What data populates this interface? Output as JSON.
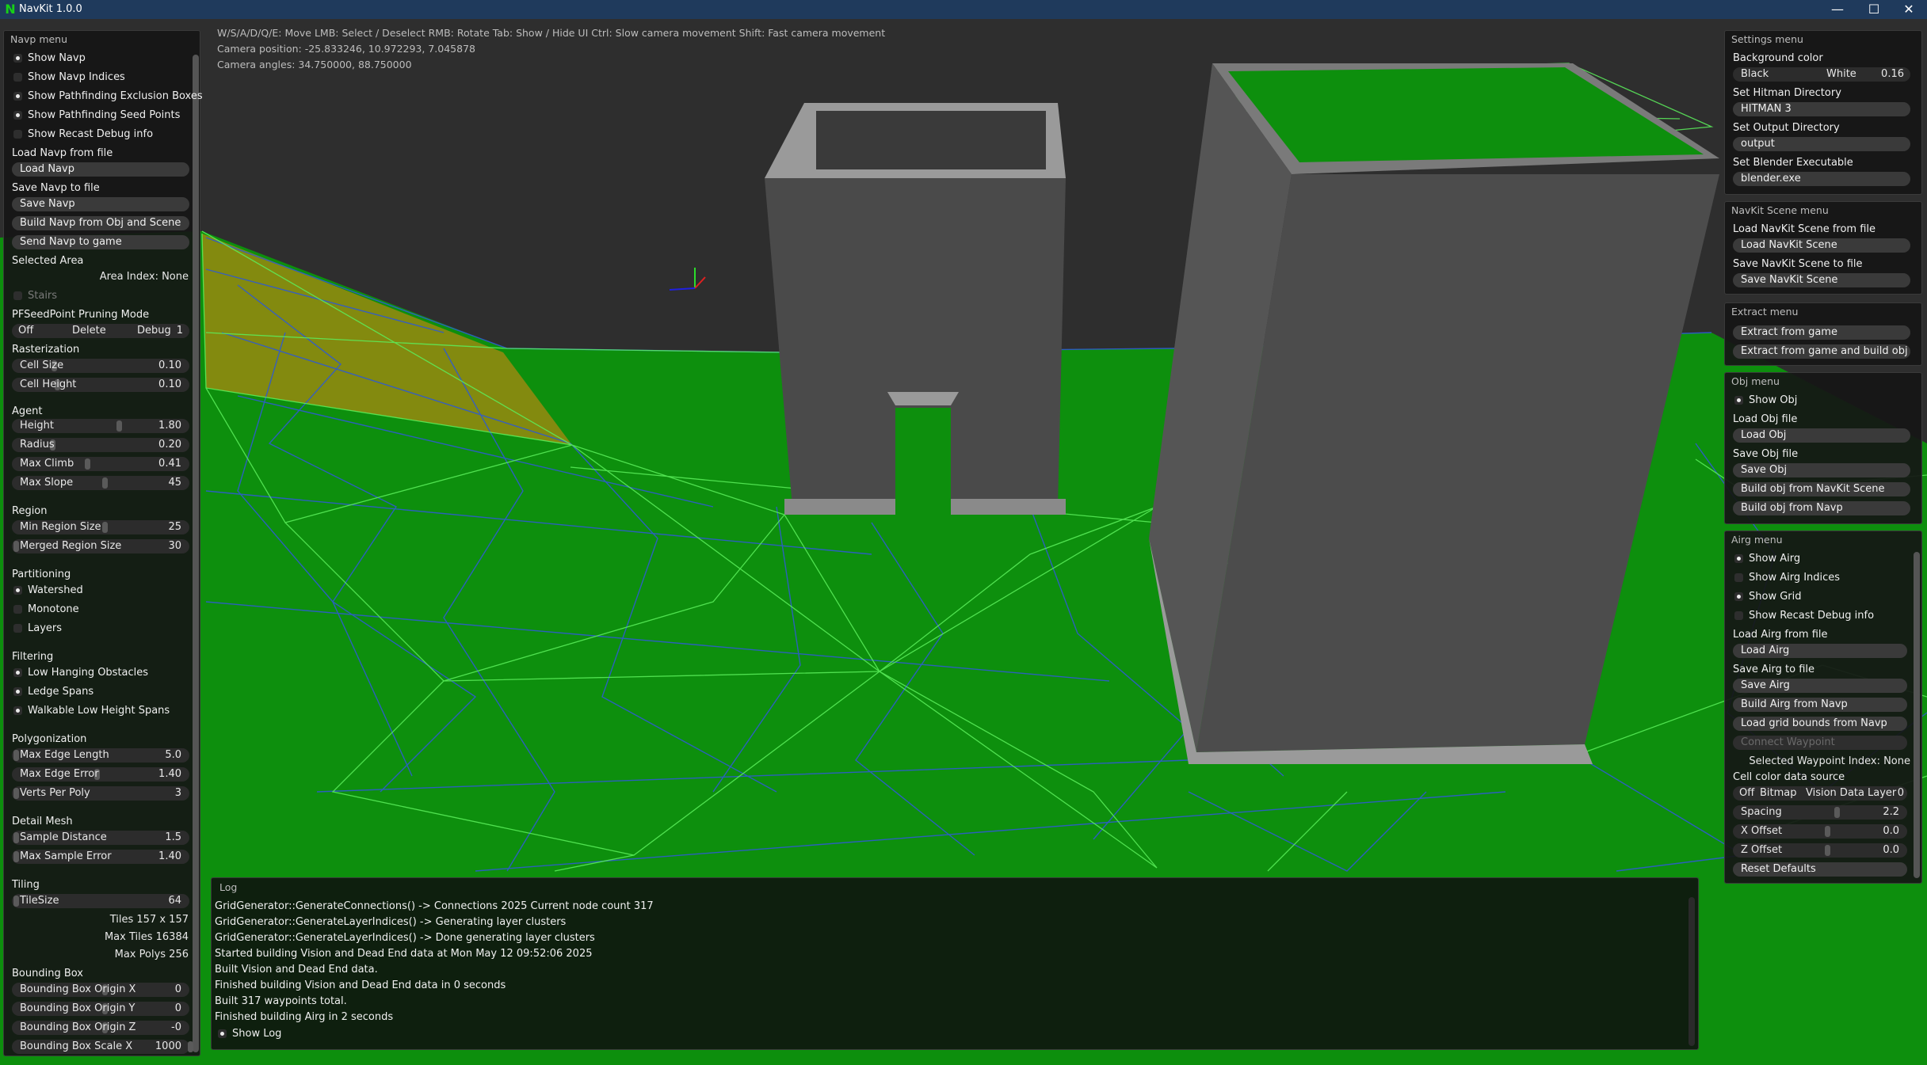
{
  "window": {
    "title": "NavKit 1.0.0",
    "logo": "N",
    "buttons": {
      "minimize": "—",
      "maximize": "☐",
      "close": "✕"
    }
  },
  "hints": [
    "W/S/A/D/Q/E: Move  LMB: Select / Deselect RMB: Rotate  Tab: Show / Hide UI  Ctrl: Slow camera movement  Shift: Fast camera movement",
    "Camera position: -25.833246, 10.972293, 7.045878",
    "Camera angles: 34.750000, 88.750000"
  ],
  "colors": {
    "ground": "#0d8f0d",
    "selected_area": "#8a8a10",
    "edge": "#2f5bcf",
    "grid": "#5cf05c",
    "building": "#4a4a4a"
  },
  "navp": {
    "title": "Navp menu",
    "checks": [
      {
        "label": "Show Navp",
        "checked": true
      },
      {
        "label": "Show Navp Indices",
        "checked": false
      },
      {
        "label": "Show Pathfinding Exclusion Boxes",
        "checked": true
      },
      {
        "label": "Show Pathfinding Seed Points",
        "checked": true
      },
      {
        "label": "Show Recast Debug info",
        "checked": false
      }
    ],
    "load_heading": "Load Navp from file",
    "load_btn": "Load Navp",
    "save_heading": "Save Navp to file",
    "save_btn": "Save Navp",
    "build_btn": "Build Navp from Obj and Scene",
    "send_btn": "Send Navp to game",
    "selected_area": "Selected Area",
    "area_index": "Area Index: None",
    "stairs": "Stairs",
    "pruning": {
      "heading": "PFSeedPoint Pruning Mode",
      "off": "Off",
      "delete": "Delete",
      "debug": "Debug",
      "value": "1"
    },
    "rasterization": {
      "heading": "Rasterization",
      "cell_size": {
        "label": "Cell Size",
        "value": "0.10"
      },
      "cell_height": {
        "label": "Cell Height",
        "value": "0.10"
      }
    },
    "agent": {
      "heading": "Agent",
      "height": {
        "label": "Height",
        "value": "1.80"
      },
      "radius": {
        "label": "Radius",
        "value": "0.20"
      },
      "max_climb": {
        "label": "Max Climb",
        "value": "0.41"
      },
      "max_slope": {
        "label": "Max Slope",
        "value": "45"
      }
    },
    "region": {
      "heading": "Region",
      "min": {
        "label": "Min Region Size",
        "value": "25"
      },
      "merged": {
        "label": "Merged Region Size",
        "value": "30"
      }
    },
    "partitioning": {
      "heading": "Partitioning",
      "watershed": "Watershed",
      "monotone": "Monotone",
      "layers": "Layers"
    },
    "filtering": {
      "heading": "Filtering",
      "low": "Low Hanging Obstacles",
      "ledge": "Ledge Spans",
      "walkable": "Walkable Low Height Spans"
    },
    "poly": {
      "heading": "Polygonization",
      "max_edge_len": {
        "label": "Max Edge Length",
        "value": "5.0"
      },
      "max_edge_err": {
        "label": "Max Edge Error",
        "value": "1.40"
      },
      "verts": {
        "label": "Verts Per Poly",
        "value": "3"
      }
    },
    "detail": {
      "heading": "Detail Mesh",
      "sample": {
        "label": "Sample Distance",
        "value": "1.5"
      },
      "max_err": {
        "label": "Max Sample Error",
        "value": "1.40"
      }
    },
    "tiling": {
      "heading": "Tiling",
      "tilesize": {
        "label": "TileSize",
        "value": "64"
      },
      "tiles": "Tiles  157 x 157",
      "max_tiles": "Max Tiles  16384",
      "max_polys": "Max Polys  256"
    },
    "bbox": {
      "heading": "Bounding Box",
      "ox": {
        "label": "Bounding Box Origin X",
        "value": "0"
      },
      "oy": {
        "label": "Bounding Box Origin Y",
        "value": "0"
      },
      "oz": {
        "label": "Bounding Box Origin Z",
        "value": "-0"
      },
      "sx": {
        "label": "Bounding Box Scale X",
        "value": "1000"
      }
    }
  },
  "settings": {
    "title": "Settings menu",
    "bg_heading": "Background color",
    "bg_black": "Black",
    "bg_white": "White",
    "bg_value": "0.16",
    "hitman_heading": "Set Hitman Directory",
    "hitman_value": "HITMAN 3",
    "output_heading": "Set Output Directory",
    "output_value": "output",
    "blender_heading": "Set Blender Executable",
    "blender_value": "blender.exe"
  },
  "scene": {
    "title": "NavKit Scene menu",
    "load_heading": "Load NavKit Scene from file",
    "load_btn": "Load NavKit Scene",
    "save_heading": "Save NavKit Scene to file",
    "save_btn": "Save NavKit Scene"
  },
  "extract": {
    "title": "Extract menu",
    "btn1": "Extract from game",
    "btn2": "Extract from game and build obj"
  },
  "obj": {
    "title": "Obj menu",
    "show": "Show Obj",
    "load_heading": "Load Obj file",
    "load_btn": "Load Obj",
    "save_heading": "Save Obj file",
    "save_btn": "Save Obj",
    "build_scene": "Build obj from NavKit Scene",
    "build_navp": "Build obj from Navp"
  },
  "airg": {
    "title": "Airg menu",
    "show": "Show Airg",
    "indices": "Show Airg Indices",
    "grid": "Show Grid",
    "recast": "Show Recast Debug info",
    "load_heading": "Load Airg from file",
    "load_btn": "Load Airg",
    "save_heading": "Save Airg to file",
    "save_btn": "Save Airg",
    "build_btn": "Build Airg from Navp",
    "bounds_btn": "Load grid bounds from Navp",
    "connect_btn": "Connect Waypoint",
    "selected": "Selected Waypoint Index: None",
    "cell_heading": "Cell color data source",
    "src_off": "Off",
    "src_bitmap": "Bitmap",
    "src_vision": "Vision Data",
    "src_layer": "Layer",
    "src_value": "0",
    "spacing": {
      "label": "Spacing",
      "value": "2.2"
    },
    "xoff": {
      "label": "X Offset",
      "value": "0.0"
    },
    "zoff": {
      "label": "Z Offset",
      "value": "0.0"
    },
    "reset_btn": "Reset Defaults"
  },
  "log": {
    "title": "Log",
    "lines": [
      "GridGenerator::GenerateConnections() -> Connections 2025 Current node count 317",
      "GridGenerator::GenerateLayerIndices() -> Generating layer clusters",
      "GridGenerator::GenerateLayerIndices() -> Done generating layer clusters",
      "Started building Vision and Dead End data at Mon May 12 09:52:06 2025",
      "Built Vision and Dead End data.",
      "Finished building Vision and Dead End data in 0 seconds",
      "Built 317 waypoints total.",
      "Finished building Airg in 2 seconds"
    ],
    "show_log": "Show Log"
  }
}
